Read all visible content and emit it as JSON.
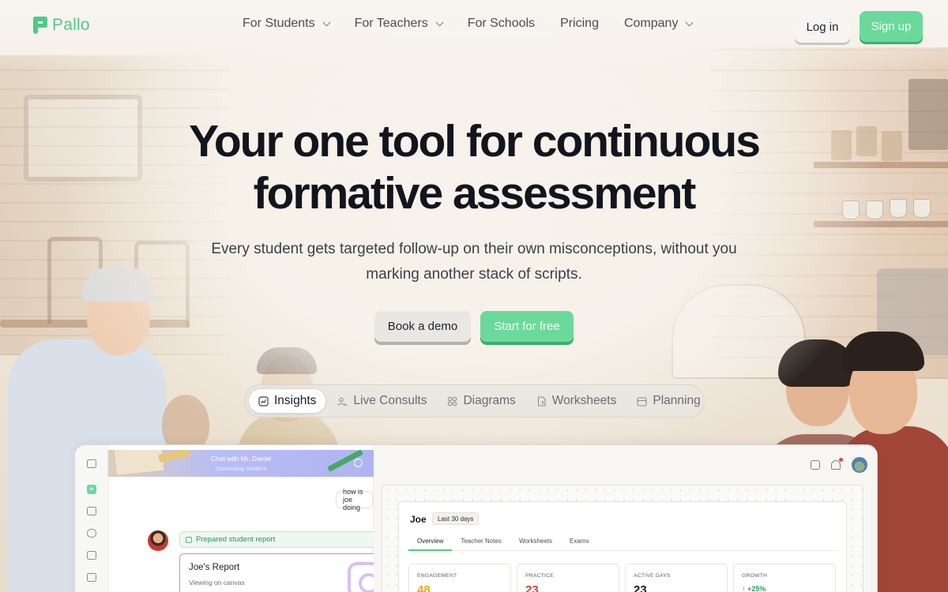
{
  "brand": {
    "name": "Pallo",
    "accent": "#4fcb85"
  },
  "nav": {
    "items": [
      {
        "label": "For Students",
        "dropdown": true
      },
      {
        "label": "For Teachers",
        "dropdown": true
      },
      {
        "label": "For Schools",
        "dropdown": false
      },
      {
        "label": "Pricing",
        "dropdown": false
      },
      {
        "label": "Company",
        "dropdown": true
      }
    ],
    "login_label": "Log in",
    "signup_label": "Sign up"
  },
  "hero": {
    "title_line1": "Your one tool for continuous",
    "title_line2": "formative assessment",
    "subtitle": "Every student gets targeted follow-up on their own misconceptions, without you marking another stack of scripts.",
    "demo_label": "Book a demo",
    "start_label": "Start for free"
  },
  "feature_tabs": {
    "active": "Insights",
    "items": [
      {
        "label": "Insights",
        "icon": "chart-icon"
      },
      {
        "label": "Live Consults",
        "icon": "people-icon"
      },
      {
        "label": "Diagrams",
        "icon": "diagram-icon"
      },
      {
        "label": "Worksheets",
        "icon": "worksheet-icon"
      },
      {
        "label": "Planning",
        "icon": "calendar-icon"
      }
    ]
  },
  "preview": {
    "chat": {
      "banner_title": "Chat with Mr. Daniel",
      "banner_subtitle": "Discussing Student",
      "user_message": "how is joe doing",
      "report_pill": "Prepared student report",
      "report_title": "Joe's Report",
      "report_subtitle": "Viewing on canvas"
    },
    "report": {
      "student": "Joe",
      "range": "Last 30 days",
      "tabs": [
        "Overview",
        "Teacher Notes",
        "Worksheets",
        "Exams"
      ],
      "active_tab": "Overview",
      "stats": [
        {
          "label": "ENGAGEMENT",
          "value": "48",
          "color": "#e8a91e"
        },
        {
          "label": "PRACTICE",
          "value": "23",
          "color": "#d9403a"
        },
        {
          "label": "ACTIVE DAYS",
          "value": "23",
          "color": "#16191f"
        },
        {
          "label": "GROWTH",
          "value": "↑ +25%",
          "color": "#2f9a5c"
        }
      ]
    }
  }
}
